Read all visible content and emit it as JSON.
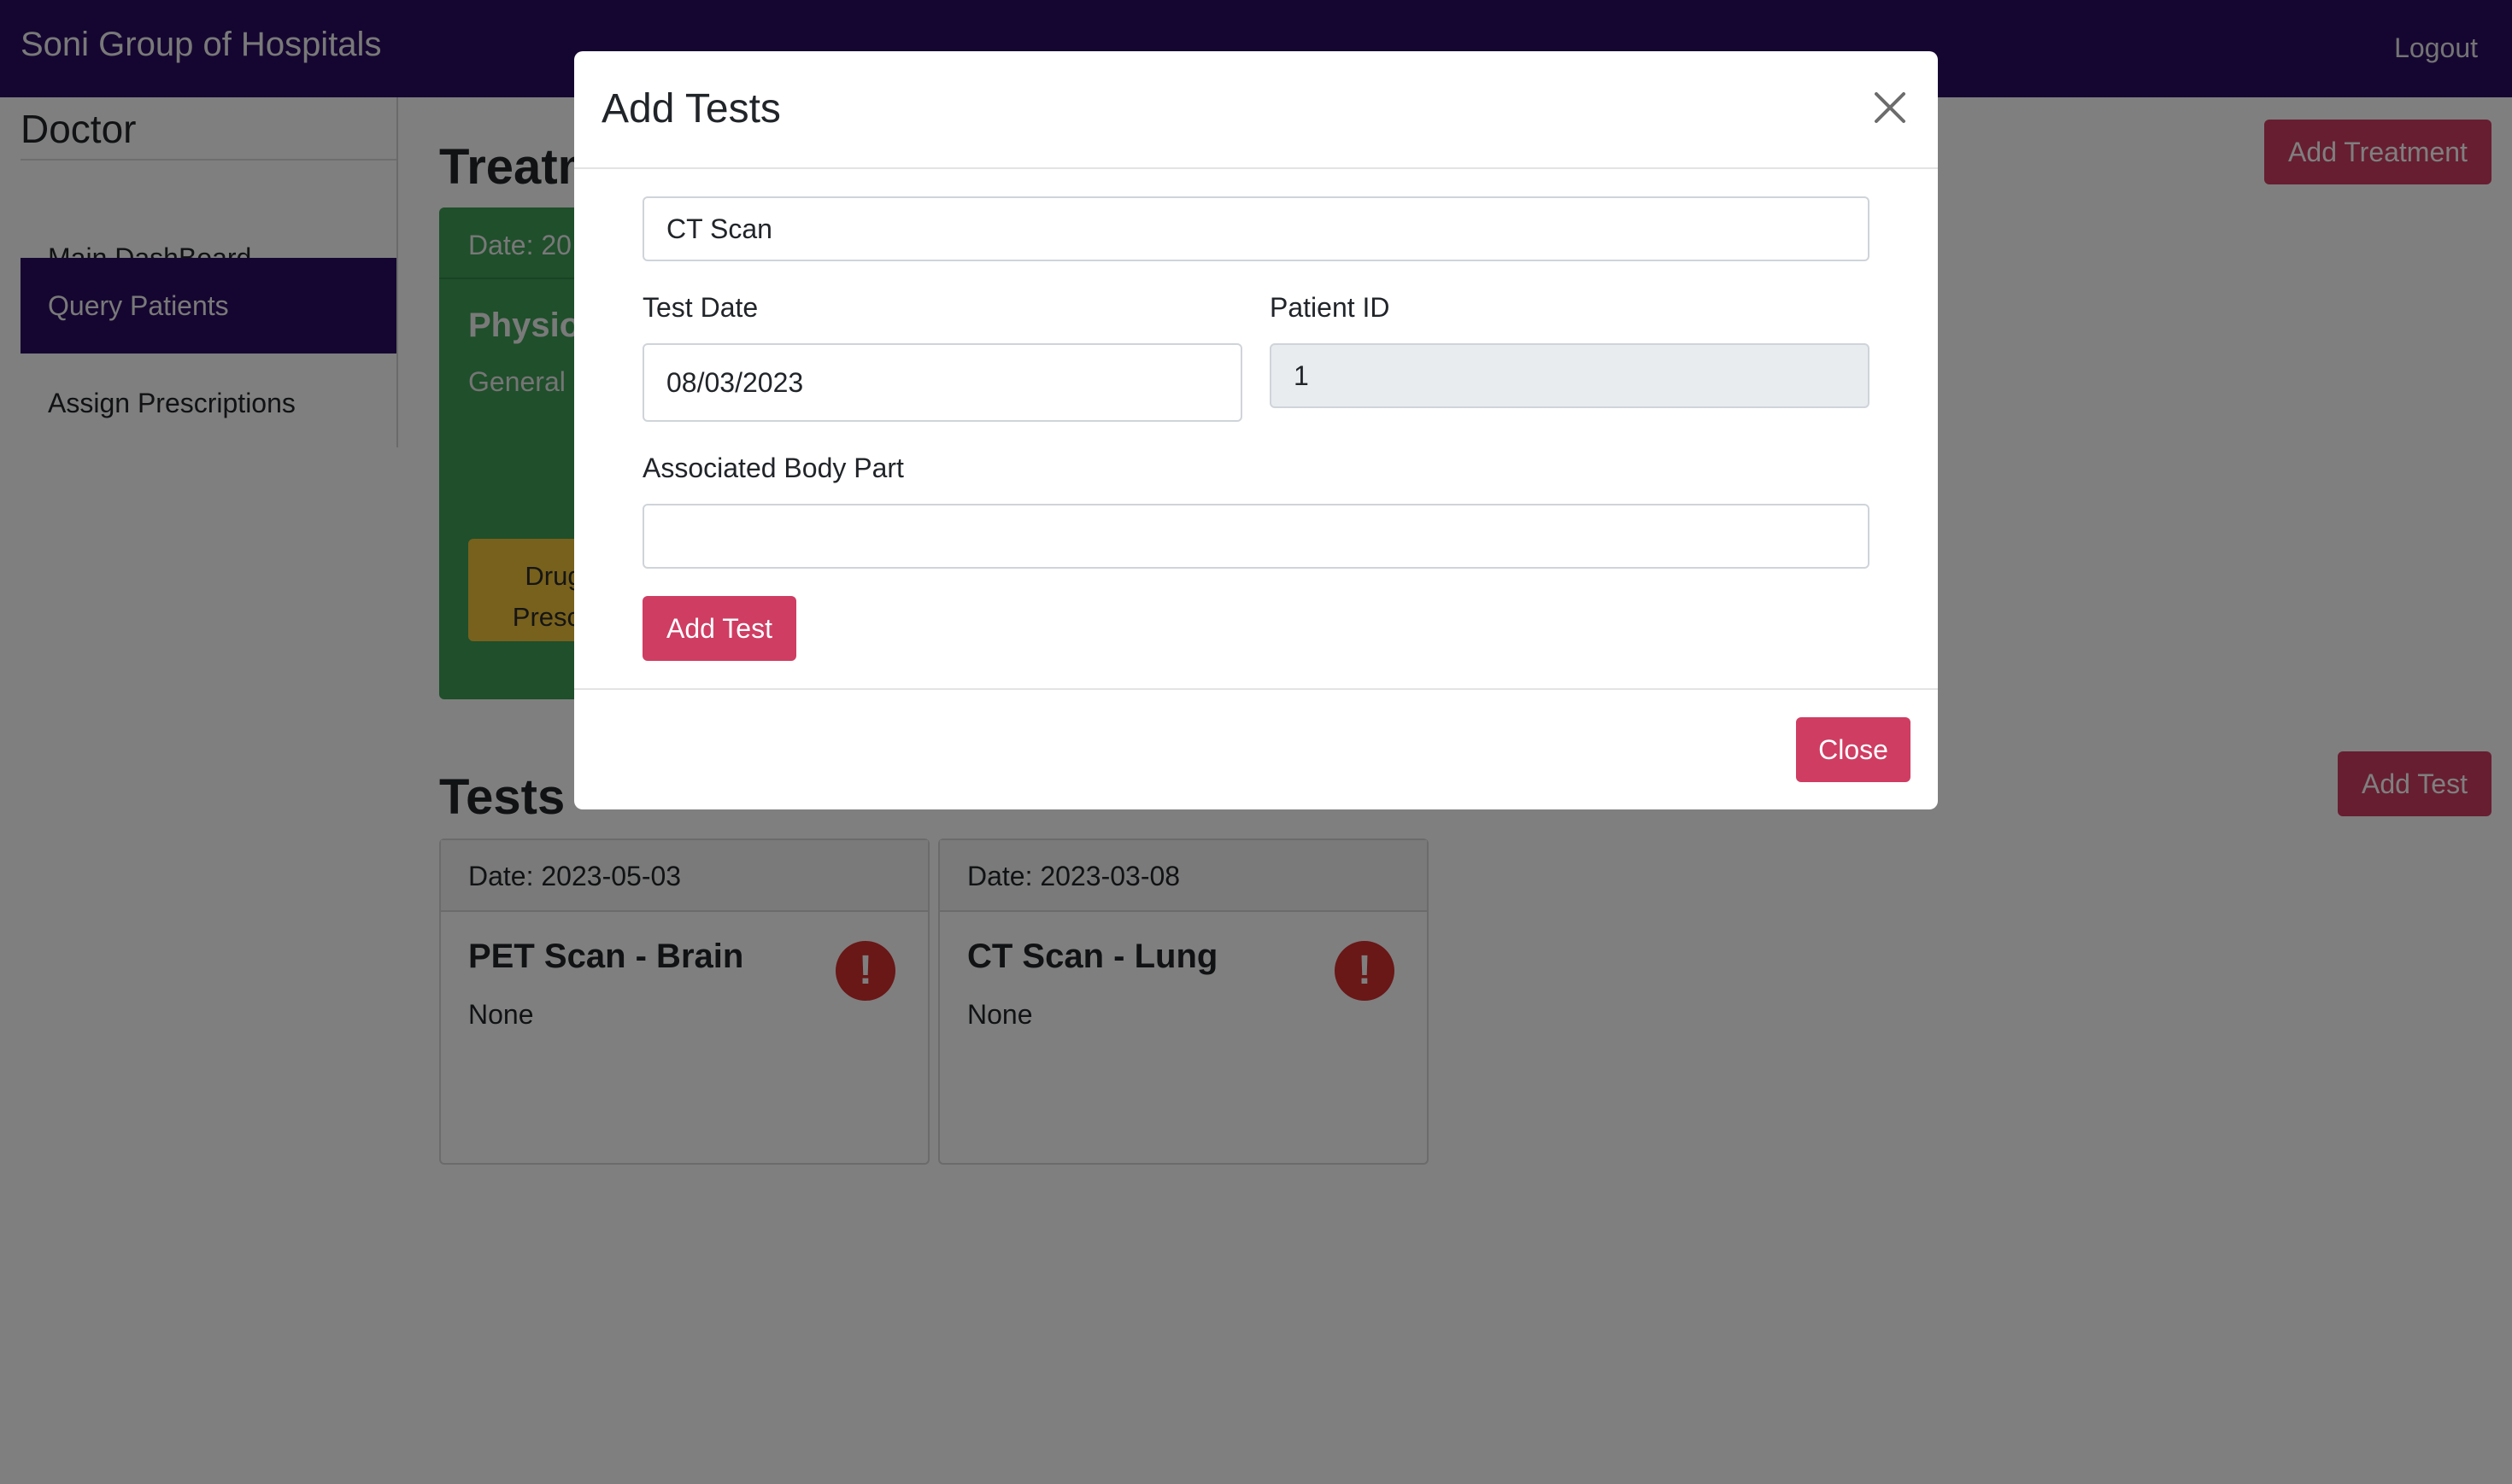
{
  "navbar": {
    "brand": "Soni Group of Hospitals",
    "logout": "Logout",
    "bg_color": "#2b0d63"
  },
  "sidebar": {
    "title": "Doctor",
    "items": [
      {
        "label": "Main DashBoard",
        "active": false
      },
      {
        "label": "Query Patients",
        "active": true
      },
      {
        "label": "Assign Prescriptions",
        "active": false
      }
    ]
  },
  "treatments": {
    "heading": "Treatm",
    "add_button": "Add Treatment",
    "card": {
      "date": "Date: 20",
      "name": "Physio",
      "desc": "General",
      "drug_button_line1": "Drug",
      "drug_button_line2": "Prescri",
      "color": "#3f9e57"
    }
  },
  "tests": {
    "heading": "Tests",
    "add_button": "Add Test",
    "cards": [
      {
        "date": "Date: 2023-05-03",
        "name": "PET Scan - Brain",
        "result": "None",
        "icon": "alert-circle-icon"
      },
      {
        "date": "Date: 2023-03-08",
        "name": "CT Scan - Lung",
        "result": "None",
        "icon": "alert-circle-icon"
      }
    ]
  },
  "modal": {
    "title": "Add Tests",
    "test_name_value": "CT Scan",
    "test_date_label": "Test Date",
    "test_date_value": "08/03/2023",
    "patient_id_label": "Patient ID",
    "patient_id_value": "1",
    "body_part_label": "Associated Body Part",
    "body_part_value": "",
    "submit_button": "Add Test",
    "close_button": "Close",
    "accent_color": "#cf3d62"
  }
}
